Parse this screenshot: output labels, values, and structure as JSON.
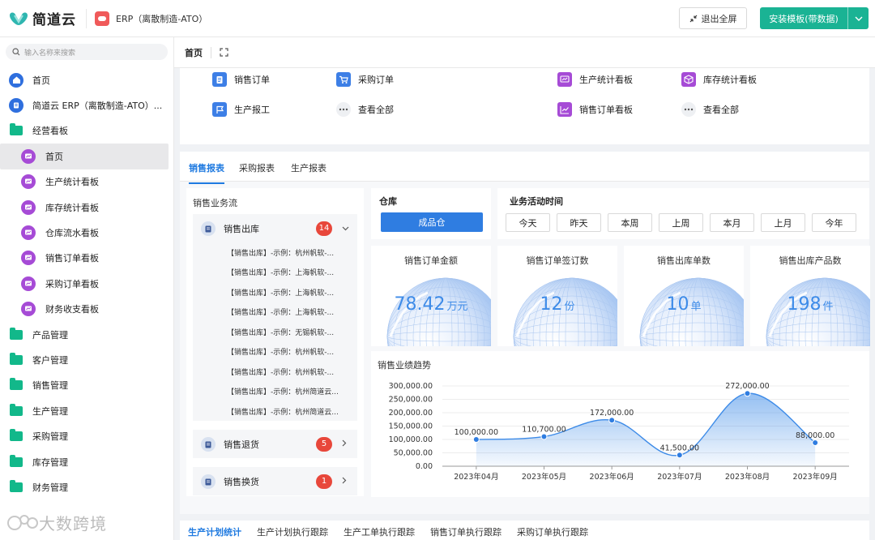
{
  "header": {
    "brand": "简道云",
    "app_title": "ERP（离散制造-ATO）",
    "exit_label": "退出全屏",
    "install_label": "安装模板(带数据)"
  },
  "sidebar": {
    "search_placeholder": "输入名称来搜索",
    "items": [
      {
        "label": "首页",
        "level": 1,
        "icon": "home-icon"
      },
      {
        "label": "简道云 ERP（离散制造-ATO）...",
        "level": 1,
        "icon": "app-icon"
      },
      {
        "label": "经营看板",
        "level": 1,
        "icon": "folder-open-icon"
      },
      {
        "label": "首页",
        "level": 2,
        "icon": "dashboard-icon",
        "active": true
      },
      {
        "label": "生产统计看板",
        "level": 2,
        "icon": "dashboard-icon"
      },
      {
        "label": "库存统计看板",
        "level": 2,
        "icon": "dashboard-icon"
      },
      {
        "label": "仓库流水看板",
        "level": 2,
        "icon": "dashboard-icon"
      },
      {
        "label": "销售订单看板",
        "level": 2,
        "icon": "dashboard-icon"
      },
      {
        "label": "采购订单看板",
        "level": 2,
        "icon": "dashboard-icon"
      },
      {
        "label": "财务收支看板",
        "level": 2,
        "icon": "dashboard-icon"
      },
      {
        "label": "产品管理",
        "level": 1,
        "icon": "folder-icon"
      },
      {
        "label": "客户管理",
        "level": 1,
        "icon": "folder-icon"
      },
      {
        "label": "销售管理",
        "level": 1,
        "icon": "folder-icon"
      },
      {
        "label": "生产管理",
        "level": 1,
        "icon": "folder-icon"
      },
      {
        "label": "采购管理",
        "level": 1,
        "icon": "folder-icon"
      },
      {
        "label": "库存管理",
        "level": 1,
        "icon": "folder-icon"
      },
      {
        "label": "财务管理",
        "level": 1,
        "icon": "folder-icon"
      }
    ],
    "watermark": "大数跨境"
  },
  "tabbar": {
    "home": "首页"
  },
  "shortcuts": [
    {
      "label": "销售订单",
      "icon": "document-icon",
      "color": "#3d7fe6"
    },
    {
      "label": "采购订单",
      "icon": "cart-icon",
      "color": "#3d7fe6"
    },
    {
      "label": "生产统计看板",
      "icon": "dashboard-icon",
      "color": "#a64bd6"
    },
    {
      "label": "库存统计看板",
      "icon": "box-icon",
      "color": "#a64bd6"
    },
    {
      "label": "生产报工",
      "icon": "flag-icon",
      "color": "#3d7fe6"
    },
    {
      "label": "查看全部",
      "icon": "more-icon",
      "color": "#666666"
    },
    {
      "label": "销售订单看板",
      "icon": "line-chart-icon",
      "color": "#a64bd6"
    },
    {
      "label": "查看全部",
      "icon": "more-icon",
      "color": "#666666"
    }
  ],
  "report": {
    "tabs": [
      "销售报表",
      "采购报表",
      "生产报表"
    ],
    "flow": {
      "title": "销售业务流",
      "groups": [
        {
          "label": "销售出库",
          "count": "14",
          "expanded": true,
          "items": [
            "【销售出库】-示例：杭州帆软-...",
            "【销售出库】-示例：上海帆软-...",
            "【销售出库】-示例：上海帆软-...",
            "【销售出库】-示例：上海帆软-...",
            "【销售出库】-示例：无锡帆软-...",
            "【销售出库】-示例：杭州帆软-...",
            "【销售出库】-示例：杭州帆软-...",
            "【销售出库】-示例：杭州简道云...",
            "【销售出库】-示例：杭州简道云..."
          ]
        },
        {
          "label": "销售退货",
          "count": "5",
          "expanded": false,
          "items": []
        },
        {
          "label": "销售换货",
          "count": "1",
          "expanded": false,
          "items": []
        }
      ]
    },
    "warehouse": {
      "title": "仓库",
      "button": "成品仓"
    },
    "time": {
      "title": "业务活动时间",
      "buttons": [
        "今天",
        "昨天",
        "本周",
        "上周",
        "本月",
        "上月",
        "今年"
      ]
    },
    "kpis": [
      {
        "title": "销售订单金额",
        "value": "78.42",
        "unit": "万元"
      },
      {
        "title": "销售订单签订数",
        "value": "12",
        "unit": "份"
      },
      {
        "title": "销售出库单数",
        "value": "10",
        "unit": "单"
      },
      {
        "title": "销售出库产品数",
        "value": "198",
        "unit": "件"
      }
    ]
  },
  "chart_data": {
    "type": "area",
    "title": "销售业绩趋势",
    "categories": [
      "2023年04月",
      "2023年05月",
      "2023年06月",
      "2023年07月",
      "2023年08月",
      "2023年09月"
    ],
    "values": [
      100000,
      110700,
      172000,
      41500,
      272000,
      88000
    ],
    "value_labels": [
      "100,000.00",
      "110,700.00",
      "172,000.00",
      "41,500.00",
      "272,000.00",
      "88,000.00"
    ],
    "y_ticks": [
      "0.00",
      "50,000.00",
      "100,000.00",
      "150,000.00",
      "200,000.00",
      "250,000.00",
      "300,000.00"
    ],
    "ylim": [
      0,
      300000
    ],
    "color": "#3d8be8",
    "grid": true
  },
  "bottom_tabs": [
    "生产计划统计",
    "生产计划执行跟踪",
    "生产工单执行跟踪",
    "销售订单执行跟踪",
    "采购订单执行跟踪"
  ]
}
